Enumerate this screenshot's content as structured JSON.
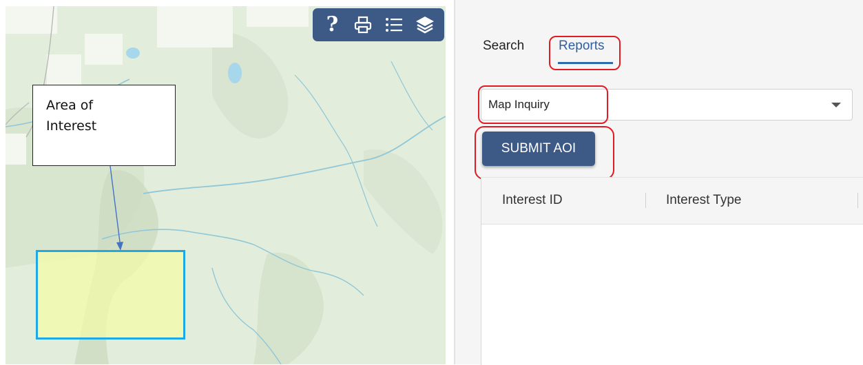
{
  "map": {
    "toolbar": {
      "help_glyph": "?",
      "icons": [
        "help-icon",
        "print-icon",
        "list-icon",
        "layers-icon"
      ],
      "background": "#3d5a87"
    },
    "callout": {
      "line1": "Area of",
      "line2": "Interest"
    },
    "aoi_border_color": "#1fa7e6",
    "aoi_fill_color": "#f8ffa0"
  },
  "panel": {
    "tabs": [
      {
        "label": "Search",
        "active": false
      },
      {
        "label": "Reports",
        "active": true
      }
    ],
    "report_select": {
      "value": "Map Inquiry"
    },
    "submit_label": "SUBMIT AOI",
    "columns": [
      "Interest ID",
      "Interest Type"
    ],
    "rows": [],
    "accent": "#3d5a87",
    "highlight_color": "#e01b22"
  }
}
